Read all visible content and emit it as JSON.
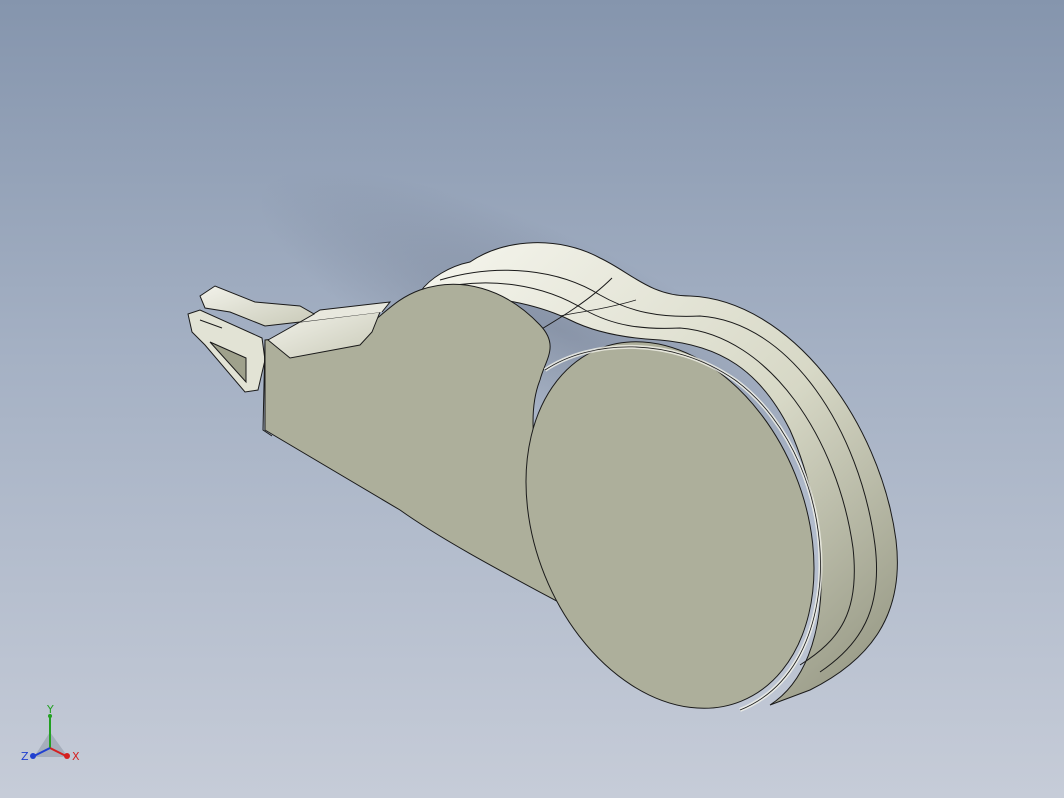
{
  "viewport": {
    "background_top": "#8595ad",
    "background_bottom": "#c6ccd8"
  },
  "model": {
    "part": "tape-dispenser-housing",
    "face_color": "#adaf9b",
    "edge_color": "#1a1a1a",
    "highlight_color": "#f4f4ec"
  },
  "triad": {
    "x_label": "X",
    "y_label": "Y",
    "z_label": "Z",
    "x_color": "#d42020",
    "y_color": "#22a022",
    "z_color": "#2040d0"
  }
}
